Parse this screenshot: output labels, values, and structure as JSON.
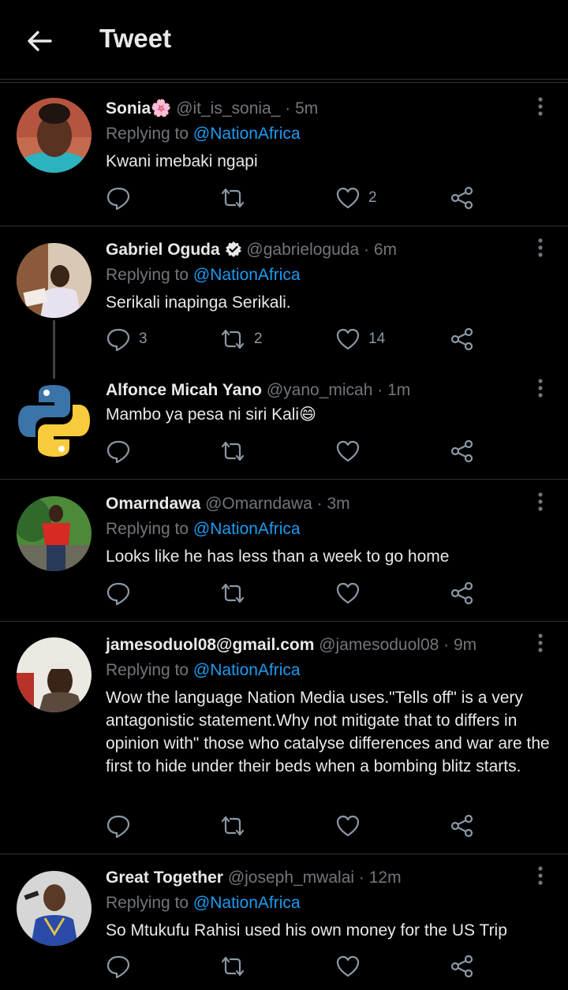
{
  "header": {
    "title": "Tweet"
  },
  "tweets": [
    {
      "name": "Sonia",
      "emoji": "🌸",
      "handle": "@it_is_sonia_",
      "time": "5m",
      "reply_prefix": "Replying to",
      "reply_to": "@NationAfrica",
      "text": "Kwani imebaki ngapi",
      "replies": "",
      "retweets": "",
      "likes": "2"
    },
    {
      "name": "Gabriel Oguda",
      "handle": "@gabrieloguda",
      "time": "6m",
      "reply_prefix": "Replying to",
      "reply_to": "@NationAfrica",
      "text": "Serikali inapinga Serikali.",
      "replies": "3",
      "retweets": "2",
      "likes": "14"
    },
    {
      "name": "Alfonce Micah Yano",
      "handle": "@yano_micah",
      "time": "1m",
      "text": "Mambo ya pesa ni siri Kali😄",
      "replies": "",
      "retweets": "",
      "likes": ""
    },
    {
      "name": "Omarndawa",
      "handle": "@Omarndawa",
      "time": "3m",
      "reply_prefix": "Replying to",
      "reply_to": "@NationAfrica",
      "text": "Looks like he has less than a week to go home",
      "replies": "",
      "retweets": "",
      "likes": ""
    },
    {
      "name": "jamesoduol08@gmail.com",
      "handle": "@jamesoduol08",
      "time": "9m",
      "reply_prefix": "Replying to",
      "reply_to": "@NationAfrica",
      "text": "Wow the language Nation Media uses.\"Tells off\" is a very antagonistic statement.Why not mitigate that to differs in opinion with\" those who catalyse differences and war are the first to hide under their beds when a bombing blitz starts.",
      "replies": "",
      "retweets": "",
      "likes": ""
    },
    {
      "name": "Great Together",
      "handle": "@joseph_mwalai",
      "time": "12m",
      "reply_prefix": "Replying to",
      "reply_to": "@NationAfrica",
      "text": "So Mtukufu Rahisi used his own money for the US Trip",
      "replies": "",
      "retweets": "",
      "likes": ""
    }
  ],
  "colors": {
    "background": "#000000",
    "accent": "#1d9bf0",
    "muted": "#71767b",
    "verified": "#e7e9ea"
  },
  "icons": [
    "back-arrow-icon",
    "more-icon",
    "reply-icon",
    "retweet-icon",
    "like-icon",
    "share-icon",
    "verified-icon"
  ]
}
